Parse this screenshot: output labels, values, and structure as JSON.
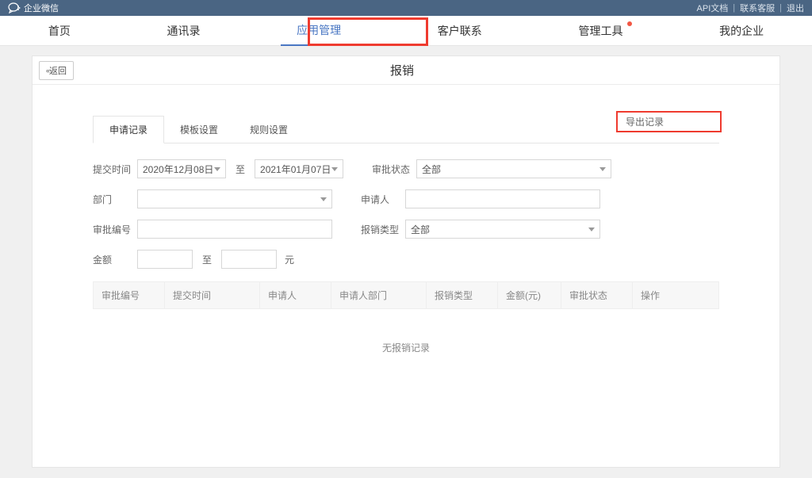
{
  "banner": {
    "brand": "企业微信",
    "links": {
      "api": "API文档",
      "contact": "联系客服",
      "logout": "退出"
    }
  },
  "mainnav": {
    "items": [
      {
        "label": "首页"
      },
      {
        "label": "通讯录"
      },
      {
        "label": "应用管理",
        "active": true
      },
      {
        "label": "客户联系"
      },
      {
        "label": "管理工具",
        "dot": true
      },
      {
        "label": "我的企业"
      }
    ]
  },
  "page": {
    "back": "返回",
    "title": "报销"
  },
  "tabs": {
    "items": [
      {
        "label": "申请记录",
        "active": true
      },
      {
        "label": "模板设置"
      },
      {
        "label": "规则设置"
      }
    ],
    "export": "导出记录"
  },
  "filters": {
    "submitTime": {
      "label": "提交时间",
      "from": "2020年12月08日",
      "to_label": "至",
      "to": "2021年01月07日"
    },
    "approvalStatus": {
      "label": "审批状态",
      "value": "全部"
    },
    "dept": {
      "label": "部门"
    },
    "applicant": {
      "label": "申请人"
    },
    "approvalNo": {
      "label": "审批编号"
    },
    "expenseType": {
      "label": "报销类型",
      "value": "全部"
    },
    "amount": {
      "label": "金额",
      "to_label": "至",
      "unit": "元"
    }
  },
  "table": {
    "headers": {
      "c1": "审批编号",
      "c2": "提交时间",
      "c3": "申请人",
      "c4": "申请人部门",
      "c5": "报销类型",
      "c6": "金额(元)",
      "c7": "审批状态",
      "c8": "操作"
    },
    "empty": "无报销记录"
  }
}
